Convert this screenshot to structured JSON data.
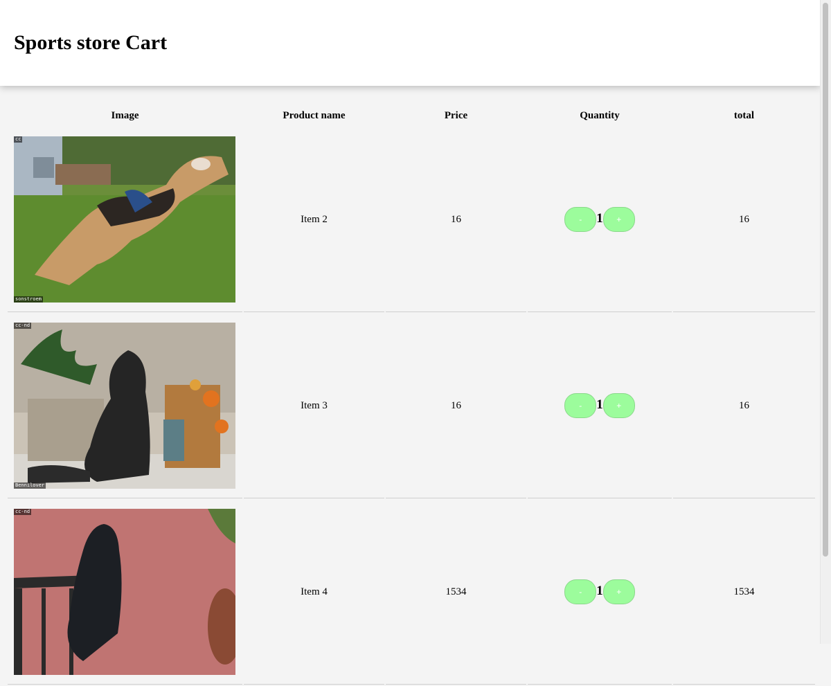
{
  "header": {
    "title": "Sports store Cart"
  },
  "table": {
    "headers": [
      "Image",
      "Product name",
      "Price",
      "Quantity",
      "total"
    ],
    "rows": [
      {
        "image": "dog-photo",
        "name": "Item 2",
        "price": "16",
        "quantity": "1",
        "total": "16",
        "license_top": "cc",
        "license_bottom": "sonstroem"
      },
      {
        "image": "dog-photo",
        "name": "Item 3",
        "price": "16",
        "quantity": "1",
        "total": "16",
        "license_top": "cc-nd",
        "license_bottom": "Bennilover"
      },
      {
        "image": "dog-photo",
        "name": "Item 4",
        "price": "1534",
        "quantity": "1",
        "total": "1534",
        "license_top": "cc-nd",
        "license_bottom": ""
      }
    ]
  },
  "controls": {
    "minus_label": "-",
    "plus_label": "+"
  },
  "colors": {
    "button": "#9cfc9c",
    "background": "#f4f4f4"
  }
}
